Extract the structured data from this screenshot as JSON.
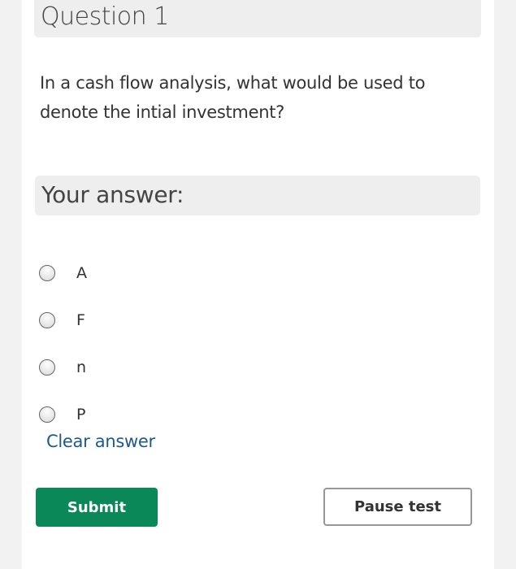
{
  "question": {
    "title": "Question 1",
    "text": "In a cash flow analysis, what would be used to denote the intial investment?"
  },
  "answer": {
    "header": "Your answer:",
    "options": [
      {
        "label": "A",
        "selected": false
      },
      {
        "label": "F",
        "selected": false
      },
      {
        "label": "n",
        "selected": false
      },
      {
        "label": "P",
        "selected": false
      }
    ],
    "clear_label": "Clear answer"
  },
  "actions": {
    "submit_label": "Submit",
    "pause_label": "Pause test"
  },
  "colors": {
    "submit_bg": "#0a8857",
    "link": "#1e5a8c"
  }
}
